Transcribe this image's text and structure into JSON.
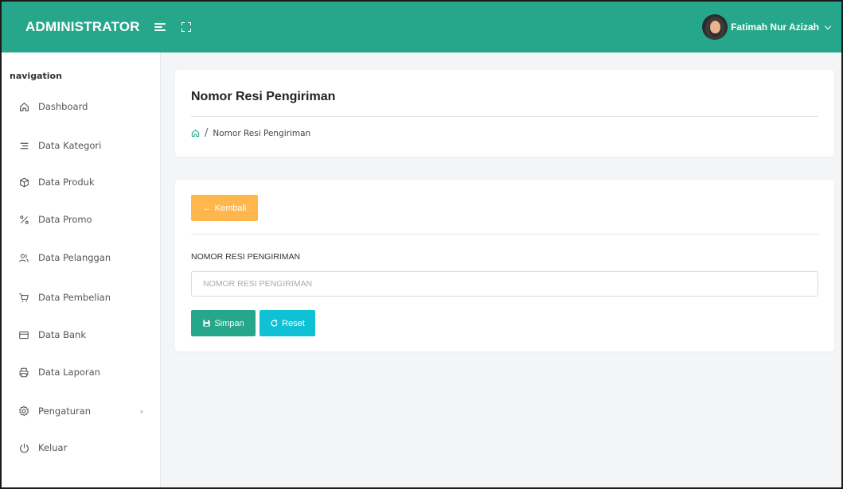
{
  "header": {
    "brand": "ADMINISTRATOR",
    "user_name": "Fatimah Nur Azizah",
    "bar_color": "#26a68a"
  },
  "sidebar": {
    "heading": "navigation",
    "items": [
      {
        "label": "Dashboard",
        "icon": "home-icon"
      },
      {
        "label": "Data Kategori",
        "icon": "list-icon"
      },
      {
        "label": "Data Produk",
        "icon": "box-icon"
      },
      {
        "label": "Data Promo",
        "icon": "percent-icon"
      },
      {
        "label": "Data Pelanggan",
        "icon": "users-icon"
      },
      {
        "label": "Data Pembelian",
        "icon": "cart-icon"
      },
      {
        "label": "Data Bank",
        "icon": "credit-card-icon"
      },
      {
        "label": "Data Laporan",
        "icon": "printer-icon"
      },
      {
        "label": "Pengaturan",
        "icon": "gear-icon",
        "has_submenu": true
      },
      {
        "label": "Keluar",
        "icon": "power-icon"
      }
    ]
  },
  "page": {
    "title": "Nomor Resi Pengiriman",
    "breadcrumb_separator": "/",
    "breadcrumb_current": "Nomor Resi Pengiriman"
  },
  "form": {
    "back_label": "Kembali",
    "field_label": "NOMOR RESI PENGIRIMAN",
    "field_placeholder": "NOMOR RESI PENGIRIMAN",
    "field_value": "",
    "save_label": "Simpan",
    "reset_label": "Reset"
  },
  "colors": {
    "primary": "#26a68a",
    "warning": "#ffb64d",
    "info": "#10c0d4"
  }
}
